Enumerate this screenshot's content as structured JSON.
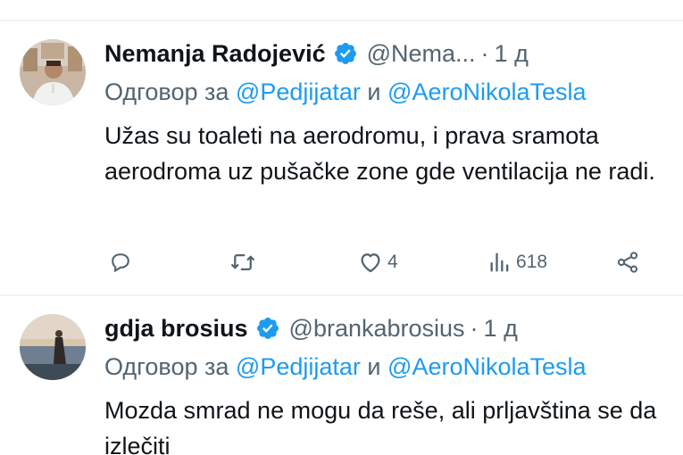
{
  "tweets": [
    {
      "name": "Nemanja Radojević",
      "handle": "@Nema...",
      "dot": "·",
      "time": "1 д",
      "reply_prefix": "Одговор за",
      "reply_mention_1": "@Pedjijatar",
      "reply_and": "и",
      "reply_mention_2": "@AeroNikolaTesla",
      "body": "Užas su toaleti na aerodromu, i prava sramota aerodroma uz pušačke zone gde ventilacija ne radi.",
      "likes": "4",
      "views": "618",
      "icons": [
        "reply-icon",
        "retweet-icon",
        "like-icon",
        "views-icon",
        "share-icon"
      ]
    },
    {
      "name": "gdja brosius",
      "handle": "@brankabrosius",
      "dot": "·",
      "time": "1 д",
      "reply_prefix": "Одговор за",
      "reply_mention_1": "@Pedjijatar",
      "reply_and": "и",
      "reply_mention_2": "@AeroNikolaTesla",
      "body": "Mozda smrad ne mogu da reše, ali prljavština se da izlečiti"
    }
  ],
  "colors": {
    "text": "#0f1419",
    "secondary": "#536471",
    "accent": "#1d9bf0",
    "divider": "#eff3f4"
  }
}
